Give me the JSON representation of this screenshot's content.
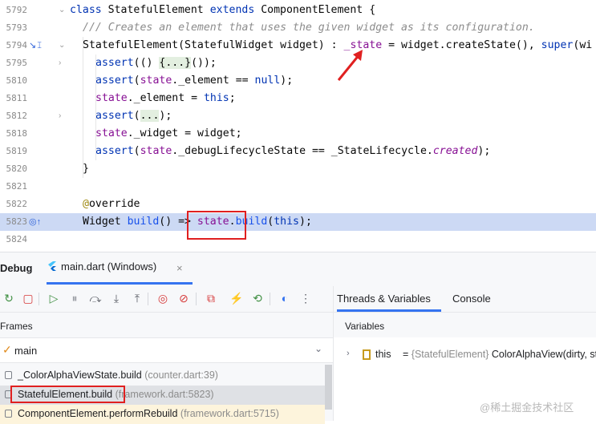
{
  "editor": {
    "lines": [
      {
        "num": "5792",
        "parts": [
          [
            "kw",
            "class "
          ],
          [
            "cls",
            "StatefulElement "
          ],
          [
            "kw",
            "extends "
          ],
          [
            "cls",
            "ComponentElement {"
          ]
        ],
        "indent": 87,
        "fold": "⌄"
      },
      {
        "num": "5793",
        "parts": [
          [
            "cm",
            "/// Creates an element that uses the given widget as its configuration."
          ]
        ],
        "indent": 103
      },
      {
        "num": "5794",
        "parts": [
          [
            "cls",
            "StatefulElement(StatefulWidget widget) : "
          ],
          [
            "fld",
            "_state"
          ],
          [
            "cls",
            " = widget.createState(), "
          ],
          [
            "kw",
            "super"
          ],
          [
            "cls",
            "(wi"
          ]
        ],
        "indent": 103,
        "fold": "⌄",
        "gutter": "↘𝙸"
      },
      {
        "num": "5795",
        "parts": [
          [
            "kw",
            "assert"
          ],
          [
            "cls",
            "(() "
          ],
          [
            "fold",
            "{...}"
          ],
          [
            "cls",
            "());"
          ]
        ],
        "indent": 119,
        "fold": "›"
      },
      {
        "num": "5810",
        "parts": [
          [
            "kw",
            "assert"
          ],
          [
            "cls",
            "("
          ],
          [
            "fld",
            "state"
          ],
          [
            "cls",
            "._element == "
          ],
          [
            "kw",
            "null"
          ],
          [
            "cls",
            ");"
          ]
        ],
        "indent": 119
      },
      {
        "num": "5811",
        "parts": [
          [
            "fld",
            "state"
          ],
          [
            "cls",
            "._element = "
          ],
          [
            "kw",
            "this"
          ],
          [
            "cls",
            ";"
          ]
        ],
        "indent": 119
      },
      {
        "num": "5812",
        "parts": [
          [
            "kw",
            "assert"
          ],
          [
            "cls",
            "("
          ],
          [
            "fold",
            "..."
          ],
          [
            "cls",
            ");"
          ]
        ],
        "indent": 119,
        "fold": "›"
      },
      {
        "num": "5818",
        "parts": [
          [
            "fld",
            "state"
          ],
          [
            "cls",
            "._widget = widget;"
          ]
        ],
        "indent": 119
      },
      {
        "num": "5819",
        "parts": [
          [
            "kw",
            "assert"
          ],
          [
            "cls",
            "("
          ],
          [
            "fld",
            "state"
          ],
          [
            "cls",
            "._debugLifecycleState == _StateLifecycle."
          ],
          [
            "en",
            "created"
          ],
          [
            "cls",
            ");"
          ]
        ],
        "indent": 119
      },
      {
        "num": "5820",
        "parts": [
          [
            "cls",
            "}"
          ]
        ],
        "indent": 103
      },
      {
        "num": "5821",
        "parts": [],
        "indent": 103
      },
      {
        "num": "5822",
        "parts": [
          [
            "ann",
            "@"
          ],
          [
            "cls",
            "override"
          ]
        ],
        "indent": 103
      },
      {
        "num": "5823",
        "parts": [
          [
            "cls",
            "Widget "
          ],
          [
            "num",
            "build"
          ],
          [
            "cls",
            "() => "
          ],
          [
            "fld",
            "state"
          ],
          [
            "cls",
            "."
          ],
          [
            "num",
            "build"
          ],
          [
            "cls",
            "("
          ],
          [
            "kw",
            "this"
          ],
          [
            "cls",
            ");"
          ]
        ],
        "indent": 103,
        "highlight": true,
        "gutter": "◎↑"
      },
      {
        "num": "5824",
        "parts": [],
        "indent": 103
      }
    ]
  },
  "debug": {
    "title": "Debug",
    "tab_label": "main.dart (Windows)",
    "tab_close": "×",
    "right_tabs": [
      "Threads & Variables",
      "Console"
    ],
    "frames_header": "Frames",
    "variables_header": "Variables",
    "thread": {
      "name": "main",
      "check": "✓",
      "dropdown": "⌄"
    },
    "frames": [
      {
        "method": "_ColorAlphaViewState.build",
        "loc": "(counter.dart:39)"
      },
      {
        "method": "StatefulElement.build",
        "loc": "(framework.dart:5823)"
      },
      {
        "method": "ComponentElement.performRebuild",
        "loc": "(framework.dart:5715)"
      }
    ],
    "variable": {
      "expander": "›",
      "name": "this",
      "equals": " = ",
      "type": "{StatefulElement}",
      "value": " ColorAlphaView(dirty, st"
    }
  },
  "toolbar_icons": [
    "rerun-icon",
    "stop-icon",
    "resume-icon",
    "pause-icon",
    "step-over-icon",
    "step-into-icon",
    "step-out-icon",
    "view-breakpoints-icon",
    "mute-breakpoints-icon",
    "settings-icon",
    "hot-reload-icon",
    "hot-restart-icon",
    "devtools-icon",
    "more-icon"
  ],
  "watermark": "@稀土掘金技术社区"
}
